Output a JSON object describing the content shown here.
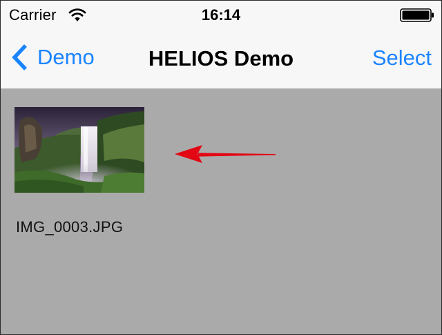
{
  "status_bar": {
    "carrier": "Carrier",
    "time": "16:14",
    "wifi_icon": "wifi-icon",
    "battery_icon": "battery-icon"
  },
  "nav_bar": {
    "back_label": "Demo",
    "title": "HELIOS Demo",
    "select_label": "Select",
    "back_icon": "chevron-left-icon"
  },
  "gallery": {
    "items": [
      {
        "file_name": "IMG_0003.JPG",
        "thumbnail": "waterfall-landscape-photo"
      }
    ]
  },
  "annotation": {
    "type": "arrow-left",
    "color": "#e30613"
  },
  "colors": {
    "accent": "#1a84ff",
    "content_background": "#aaaaaa",
    "bar_background": "#f7f7f7"
  }
}
